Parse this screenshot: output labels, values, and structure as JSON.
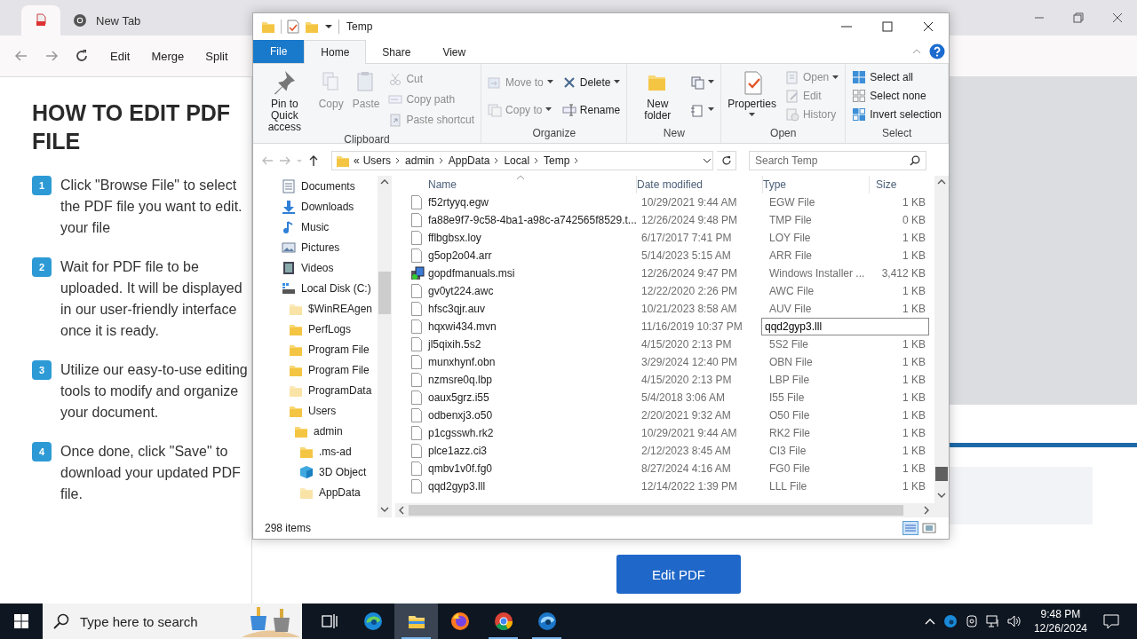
{
  "browser": {
    "tabs": [
      {
        "kind": "pdf",
        "selected": true
      },
      {
        "kind": "chrome",
        "label": "New Tab",
        "selected": false
      }
    ],
    "nav_links": [
      "Edit",
      "Merge",
      "Split"
    ]
  },
  "page": {
    "heading": "HOW TO EDIT PDF FILE",
    "steps": [
      {
        "number": "1",
        "text": "Click \"Browse File\" to select the PDF file you want to edit. your file"
      },
      {
        "number": "2",
        "text": "Wait for PDF file to be uploaded. It will be displayed in our user-friendly interface once it is ready."
      },
      {
        "number": "3",
        "text": "Utilize our easy-to-use editing tools to modify and organize your document."
      },
      {
        "number": "4",
        "text": "Once done, click \"Save\" to download your updated PDF file."
      }
    ],
    "button": "Edit PDF"
  },
  "explorer": {
    "title": "Temp",
    "ribbon_tabs": [
      {
        "label": "File",
        "kind": "file",
        "selected": false
      },
      {
        "label": "Home",
        "kind": "tab",
        "selected": true
      },
      {
        "label": "Share",
        "kind": "tab",
        "selected": false
      },
      {
        "label": "View",
        "kind": "tab",
        "selected": false
      }
    ],
    "groups": [
      {
        "label": "Clipboard",
        "large": [
          {
            "label": "Pin to Quick access",
            "kind": "pin",
            "disabled": false,
            "dropdown": false
          },
          {
            "label": "Copy",
            "kind": "copy",
            "disabled": true,
            "dropdown": false
          },
          {
            "label": "Paste",
            "kind": "paste",
            "disabled": true,
            "dropdown": false
          }
        ],
        "stacks": [
          [
            {
              "label": "Cut",
              "kind": "cut",
              "disabled": true,
              "dropdown": false
            },
            {
              "label": "Copy path",
              "kind": "copypath",
              "disabled": true,
              "dropdown": false
            },
            {
              "label": "Paste shortcut",
              "kind": "pasteshortcut",
              "disabled": true,
              "dropdown": false
            }
          ]
        ]
      },
      {
        "label": "Organize",
        "stacks": [
          [
            {
              "label": "Move to",
              "kind": "moveto",
              "disabled": true,
              "dropdown": true
            },
            {
              "label": "Copy to",
              "kind": "copyto",
              "disabled": true,
              "dropdown": true
            }
          ],
          [
            {
              "label": "Delete",
              "kind": "delete",
              "disabled": false,
              "dropdown": true
            },
            {
              "label": "Rename",
              "kind": "rename",
              "disabled": false,
              "dropdown": false
            }
          ]
        ]
      },
      {
        "label": "New",
        "large": [
          {
            "label": "New folder",
            "kind": "newfolder",
            "disabled": false,
            "dropdown": false
          }
        ],
        "stacks": [
          [
            {
              "kind": "newitem",
              "disabled": false,
              "dropdown": true
            },
            {
              "kind": "easyaccess",
              "disabled": false,
              "dropdown": true
            }
          ]
        ]
      },
      {
        "label": "Open",
        "large": [
          {
            "label": "Properties",
            "kind": "properties",
            "disabled": false,
            "dropdown": true
          }
        ],
        "stacks": [
          [
            {
              "label": "Open",
              "kind": "open",
              "disabled": true,
              "dropdown": true
            },
            {
              "label": "Edit",
              "kind": "edit",
              "disabled": true,
              "dropdown": false
            },
            {
              "label": "History",
              "kind": "history",
              "disabled": true,
              "dropdown": false
            }
          ]
        ]
      },
      {
        "label": "Select",
        "stacks": [
          [
            {
              "label": "Select all",
              "kind": "selectall",
              "disabled": false,
              "dropdown": false
            },
            {
              "label": "Select none",
              "kind": "selectnone",
              "disabled": false,
              "dropdown": false
            },
            {
              "label": "Invert selection",
              "kind": "invert",
              "disabled": false,
              "dropdown": false
            }
          ]
        ]
      }
    ],
    "address": {
      "overflow": "«",
      "crumbs": [
        "Users",
        "admin",
        "AppData",
        "Local",
        "Temp"
      ]
    },
    "search": {
      "placeholder": "Search Temp"
    },
    "nav": [
      {
        "label": "Documents",
        "kind": "documents"
      },
      {
        "label": "Downloads",
        "kind": "downloads"
      },
      {
        "label": "Music",
        "kind": "music"
      },
      {
        "label": "Pictures",
        "kind": "pictures"
      },
      {
        "label": "Videos",
        "kind": "videos"
      },
      {
        "label": "Local Disk (C:)",
        "kind": "disk",
        "children": [
          {
            "label": "$WinREAgen",
            "kind": "hidden-folder"
          },
          {
            "label": "PerfLogs",
            "kind": "folder"
          },
          {
            "label": "Program File",
            "kind": "folder"
          },
          {
            "label": "Program File",
            "kind": "folder"
          },
          {
            "label": "ProgramData",
            "kind": "hidden-folder"
          },
          {
            "label": "Users",
            "kind": "folder",
            "children": [
              {
                "label": "admin",
                "kind": "folder",
                "children": [
                  {
                    "label": ".ms-ad",
                    "kind": "folder"
                  },
                  {
                    "label": "3D Object",
                    "kind": "cube"
                  },
                  {
                    "label": "AppData",
                    "kind": "hidden-folder"
                  }
                ]
              }
            ]
          }
        ]
      }
    ],
    "columns": [
      "Name",
      "Date modified",
      "Type",
      "Size"
    ],
    "rows": [
      {
        "name": "f52rtyyq.egw",
        "date": "10/29/2021 9:44 AM",
        "type": "EGW File",
        "size": "1 KB",
        "kind": "file",
        "renaming": false
      },
      {
        "name": "fa88e9f7-9c58-4ba1-a98c-a742565f8529.t...",
        "date": "12/26/2024 9:48 PM",
        "type": "TMP File",
        "size": "0 KB",
        "kind": "file",
        "renaming": false
      },
      {
        "name": "fflbgbsx.loy",
        "date": "6/17/2017 7:41 PM",
        "type": "LOY File",
        "size": "1 KB",
        "kind": "file",
        "renaming": false
      },
      {
        "name": "g5op2o04.arr",
        "date": "5/14/2023 5:15 AM",
        "type": "ARR File",
        "size": "1 KB",
        "kind": "file",
        "renaming": false
      },
      {
        "name": "gopdfmanuals.msi",
        "date": "12/26/2024 9:47 PM",
        "type": "Windows Installer ...",
        "size": "3,412 KB",
        "kind": "installer",
        "renaming": false
      },
      {
        "name": "gv0yt224.awc",
        "date": "12/22/2020 2:26 PM",
        "type": "AWC File",
        "size": "1 KB",
        "kind": "file",
        "renaming": false
      },
      {
        "name": "hfsc3qjr.auv",
        "date": "10/21/2023 8:58 AM",
        "type": "AUV File",
        "size": "1 KB",
        "kind": "file",
        "renaming": false
      },
      {
        "name": "hqxwi434.mvn",
        "date": "11/16/2019 10:37 PM",
        "kind": "file",
        "renaming": true
      },
      {
        "name": "jl5qixih.5s2",
        "date": "4/15/2020 2:13 PM",
        "type": "5S2 File",
        "size": "1 KB",
        "kind": "file",
        "renaming": false
      },
      {
        "name": "munxhynf.obn",
        "date": "3/29/2024 12:40 PM",
        "type": "OBN File",
        "size": "1 KB",
        "kind": "file",
        "renaming": false
      },
      {
        "name": "nzmsre0q.lbp",
        "date": "4/15/2020 2:13 PM",
        "type": "LBP File",
        "size": "1 KB",
        "kind": "file",
        "renaming": false
      },
      {
        "name": "oaux5grz.i55",
        "date": "5/4/2018 3:06 AM",
        "type": "I55 File",
        "size": "1 KB",
        "kind": "file",
        "renaming": false
      },
      {
        "name": "odbenxj3.o50",
        "date": "2/20/2021 9:32 AM",
        "type": "O50 File",
        "size": "1 KB",
        "kind": "file",
        "renaming": false
      },
      {
        "name": "p1cgsswh.rk2",
        "date": "10/29/2021 9:44 AM",
        "type": "RK2 File",
        "size": "1 KB",
        "kind": "file",
        "renaming": false
      },
      {
        "name": "plce1azz.ci3",
        "date": "2/12/2023 8:45 AM",
        "type": "CI3 File",
        "size": "1 KB",
        "kind": "file",
        "renaming": false
      },
      {
        "name": "qmbv1v0f.fg0",
        "date": "8/27/2024 4:16 AM",
        "type": "FG0 File",
        "size": "1 KB",
        "kind": "file",
        "renaming": false
      },
      {
        "name": "qqd2gyp3.lll",
        "date": "12/14/2022 1:39 PM",
        "type": "LLL File",
        "size": "1 KB",
        "kind": "file",
        "renaming": false
      }
    ],
    "rename_box": {
      "value": "qqd2gyp3.lll"
    },
    "status": "298 items"
  },
  "taskbar": {
    "search": {
      "placeholder": "Type here to search"
    },
    "apps": [
      {
        "kind": "taskview",
        "running": false,
        "active": false
      },
      {
        "kind": "edge",
        "running": false,
        "active": false
      },
      {
        "kind": "explorer",
        "running": true,
        "active": true
      },
      {
        "kind": "firefox",
        "running": false,
        "active": false
      },
      {
        "kind": "chrome",
        "running": true,
        "active": false
      },
      {
        "kind": "edgebeta",
        "running": true,
        "active": false
      }
    ],
    "time": "9:48 PM",
    "date": "12/26/2024"
  }
}
